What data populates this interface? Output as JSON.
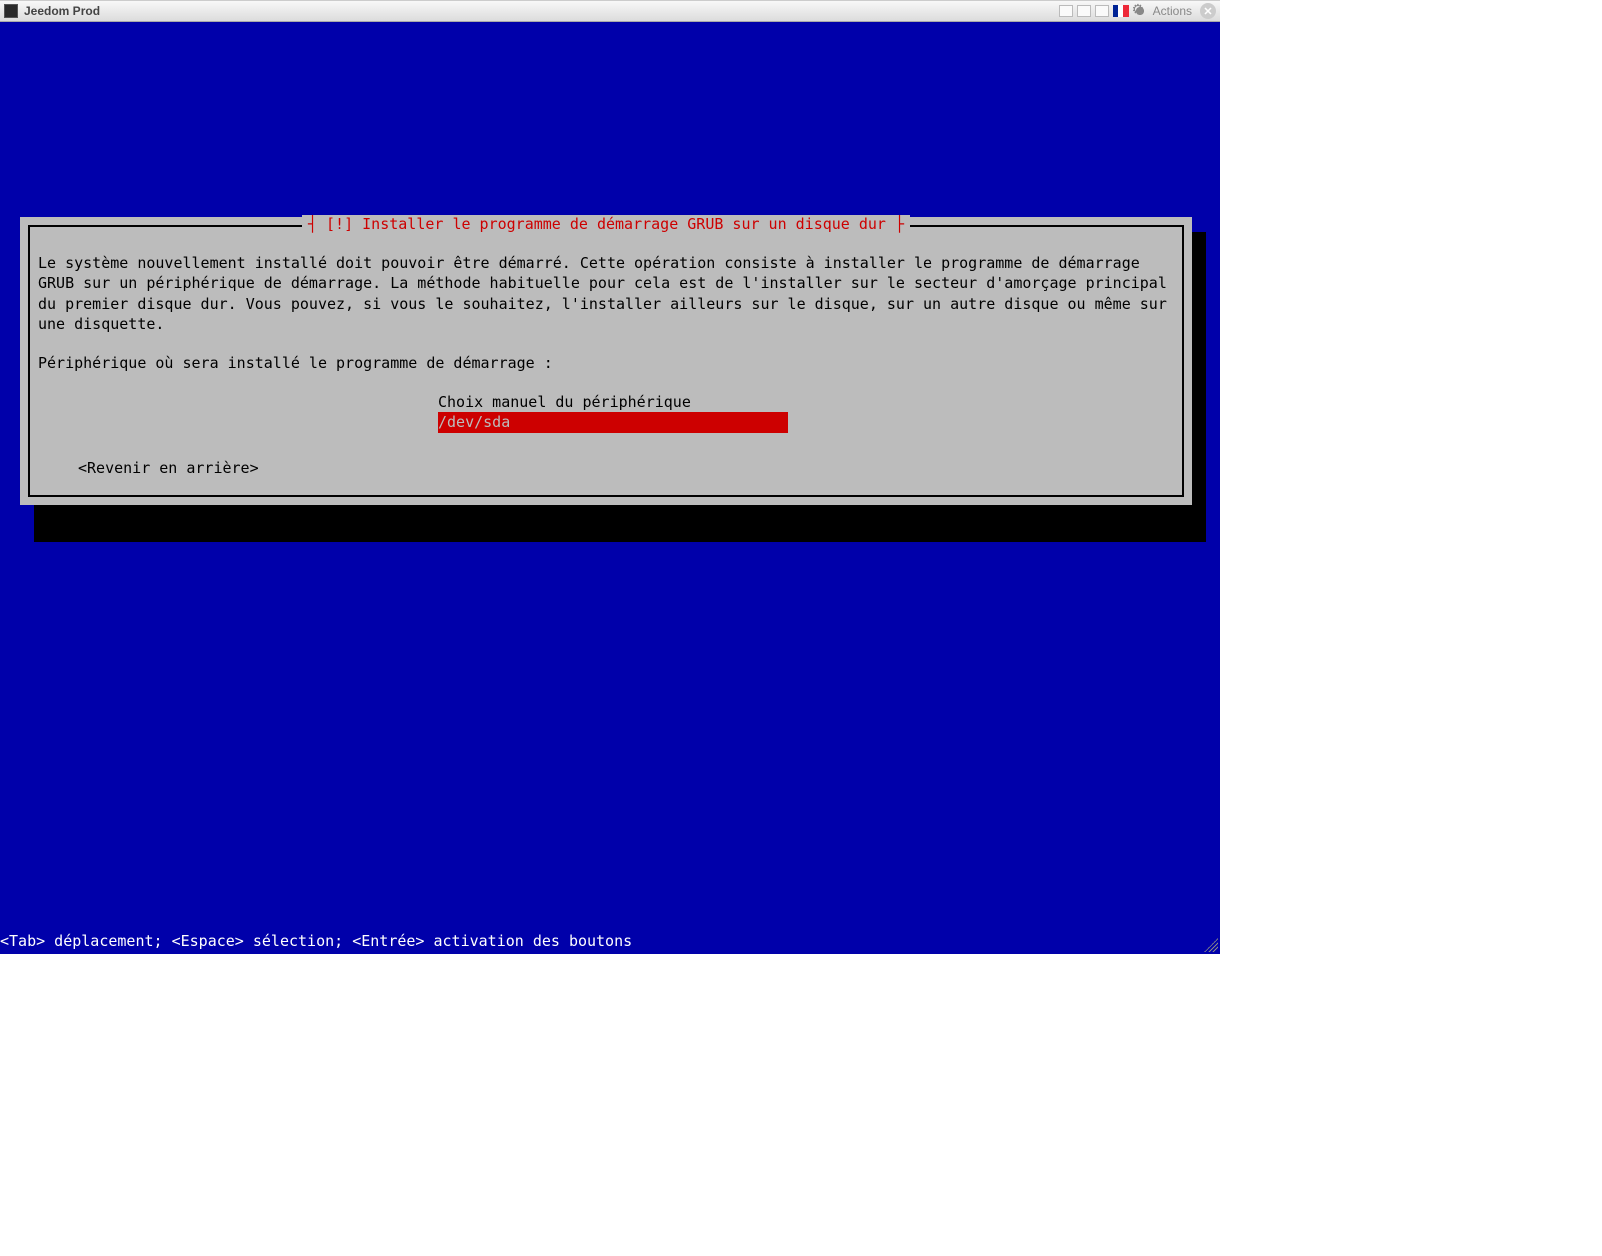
{
  "titlebar": {
    "title": "Jeedom Prod",
    "actions_label": "Actions"
  },
  "dialog": {
    "title": "[!] Installer le programme de démarrage GRUB sur un disque dur",
    "body": "Le système nouvellement installé doit pouvoir être démarré. Cette opération consiste à installer le programme de démarrage GRUB sur un périphérique de démarrage. La méthode habituelle pour cela est de l'installer sur le secteur d'amorçage principal du premier disque dur. Vous pouvez, si vous le souhaitez, l'installer ailleurs sur le disque, sur un autre disque ou même sur une disquette.",
    "prompt": "Périphérique où sera installé le programme de démarrage :",
    "options": [
      {
        "label": "Choix manuel du périphérique",
        "selected": false
      },
      {
        "label": "/dev/sda",
        "selected": true
      }
    ],
    "back_label": "<Revenir en arrière>"
  },
  "footer_hint": "<Tab> déplacement; <Espace> sélection; <Entrée> activation des boutons"
}
